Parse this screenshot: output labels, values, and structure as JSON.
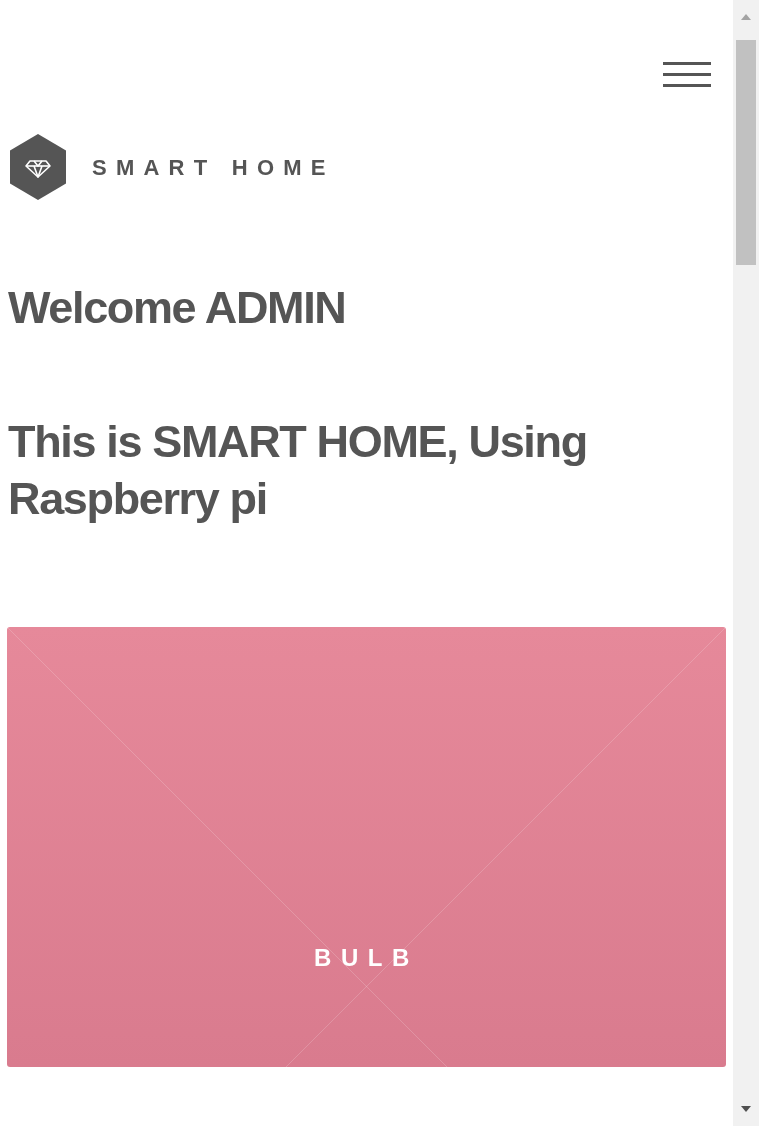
{
  "brand": {
    "text": "SMART HOME"
  },
  "headings": [
    "Welcome ADMIN",
    "This is SMART HOME, Using Raspberry pi"
  ],
  "cards": [
    {
      "label": "BULB"
    }
  ]
}
